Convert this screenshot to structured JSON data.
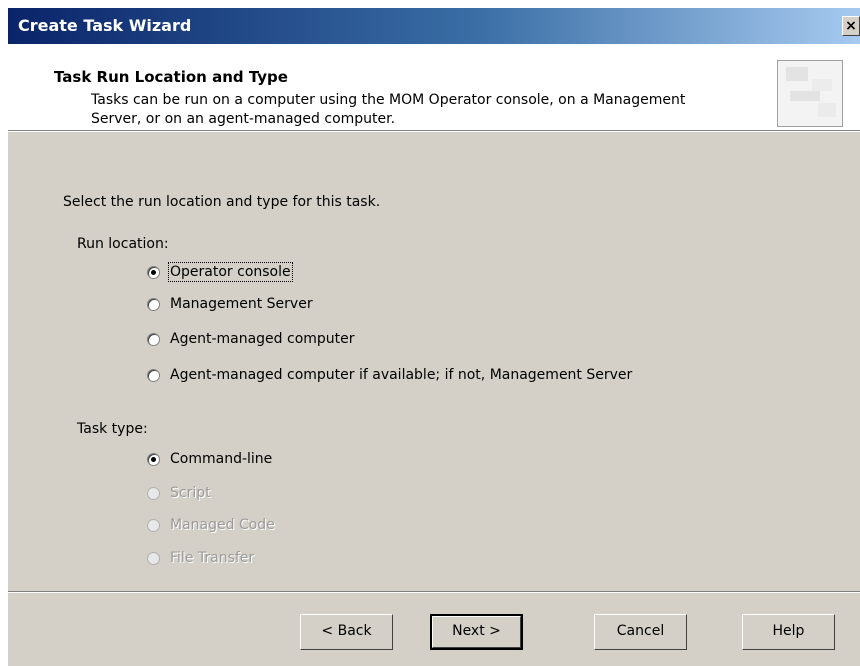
{
  "window": {
    "title": "Create Task Wizard",
    "close_label": "×"
  },
  "header": {
    "title": "Task Run Location and Type",
    "description": "Tasks can be run on a computer using the MOM Operator console, on a Management Server, or on an agent-managed computer."
  },
  "content": {
    "instruction": "Select the run location and type for this task.",
    "run_location": {
      "label": "Run location:",
      "options": [
        {
          "label": "Operator console",
          "checked": true,
          "disabled": false
        },
        {
          "label": "Management Server",
          "checked": false,
          "disabled": false
        },
        {
          "label": "Agent-managed computer",
          "checked": false,
          "disabled": false
        },
        {
          "label": "Agent-managed computer if available; if not, Management Server",
          "checked": false,
          "disabled": false
        }
      ]
    },
    "task_type": {
      "label": "Task type:",
      "options": [
        {
          "label": "Command-line",
          "checked": true,
          "disabled": false
        },
        {
          "label": "Script",
          "checked": false,
          "disabled": true
        },
        {
          "label": "Managed Code",
          "checked": false,
          "disabled": true
        },
        {
          "label": "File Transfer",
          "checked": false,
          "disabled": true
        }
      ]
    }
  },
  "buttons": {
    "back": "< Back",
    "next": "Next >",
    "cancel": "Cancel",
    "help": "Help"
  }
}
